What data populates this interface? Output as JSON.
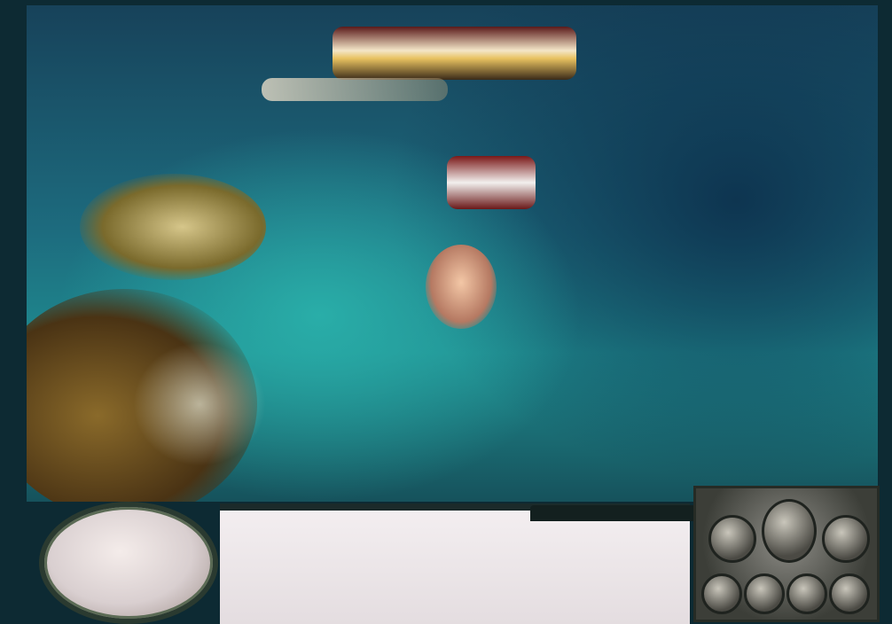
{
  "scene": {
    "water_colors": [
      "#1f8b8f",
      "#17425a",
      "#2ab0aa"
    ],
    "land_colors": [
      "#7a6a2c",
      "#b7a76a",
      "#3d2b12"
    ]
  },
  "hud": {
    "minimap": {
      "icon": "minimap-disc"
    },
    "message_panel": {
      "text": ""
    },
    "command_panel": {
      "buttons": [
        "command-button-1",
        "command-button-2",
        "command-button-3",
        "command-button-4",
        "command-button-5",
        "command-button-6",
        "command-button-7"
      ]
    }
  },
  "units": [
    {
      "label": "",
      "icon": "ship-icon"
    },
    {
      "label": "",
      "icon": "ship-icon"
    },
    {
      "label": "",
      "icon": "creature-icon"
    }
  ]
}
